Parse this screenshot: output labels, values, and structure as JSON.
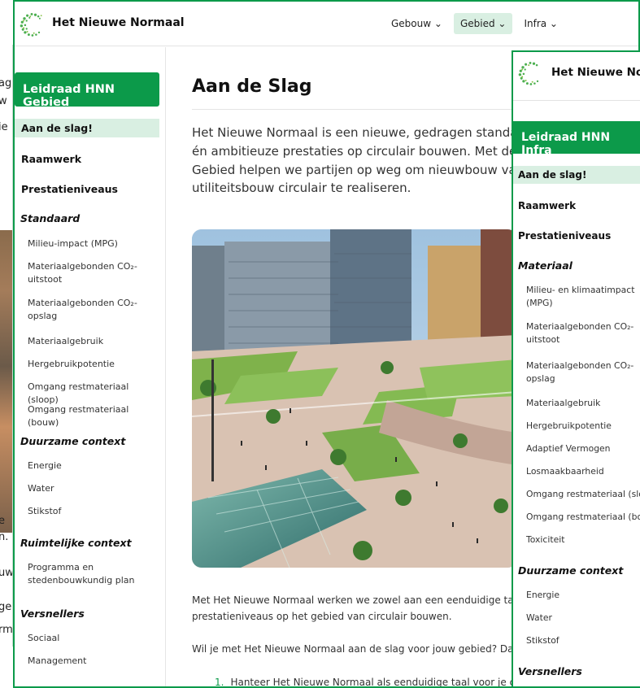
{
  "background_window": {
    "fragments": [
      "ag",
      "w",
      "ie",
      "e",
      "n.",
      "uw",
      "ge",
      "rm"
    ]
  },
  "brand": {
    "name": "Het Nieuwe Normaal"
  },
  "nav": [
    {
      "label": "Gebouw ⌄"
    },
    {
      "label": "Gebied ⌄"
    },
    {
      "label": "Infra ⌄"
    }
  ],
  "sidebar": {
    "title": "Leidraad HNN Gebied",
    "items": [
      {
        "label": "Aan de slag!"
      },
      {
        "label": "Raamwerk"
      },
      {
        "label": "Prestatieniveaus"
      }
    ],
    "sections": [
      {
        "heading": "Standaard",
        "items": [
          "Milieu-impact (MPG)",
          "Materiaalgebonden CO₂-uitstoot",
          "Materiaalgebonden CO₂-opslag",
          "Materiaalgebruik",
          "Hergebruikpotentie",
          "Omgang restmateriaal (sloop)",
          "Omgang restmateriaal (bouw)"
        ]
      },
      {
        "heading": "Duurzame context",
        "items": [
          "Energie",
          "Water",
          "Stikstof"
        ]
      },
      {
        "heading": "Ruimtelijke context",
        "items": [
          "Programma en stedenbouwkundig plan"
        ]
      },
      {
        "heading": "Versnellers",
        "items": [
          "Sociaal",
          "Management"
        ]
      }
    ]
  },
  "content": {
    "title": "Aan de Slag",
    "intro": "Het Nieuwe Normaal is een nieuwe, gedragen standaard én ambitieuze prestaties op circulair bouwen. Met de l Gebied helpen we partijen op weg om nieuwbouw van utiliteitsbouw circulair te realiseren.",
    "intro_lines": [
      "Het Nieuwe Normaal is een nieuwe, gedragen standaa",
      "én ambitieuze prestaties op circulair bouwen. Met de l",
      "Gebied helpen we partijen op weg om nieuwbouw van",
      "utiliteitsbouw circulair te realiseren."
    ],
    "p2_lines": [
      "Met Het Nieuwe Normaal werken we zowel aan een eenduidige taal",
      "prestatieniveaus op het gebied van circulair bouwen."
    ],
    "p3": "Wil je met Het Nieuwe Normaal aan de slag voor jouw gebied? Dan z",
    "list_num": "1.",
    "list_item": "Hanteer Het Nieuwe Normaal als eenduidige taal voor je circ"
  },
  "window2": {
    "brand": "Het Nieuwe Norr",
    "title": "Leidraad HNN Infra",
    "items": [
      "Aan de slag!",
      "Raamwerk",
      "Prestatieniveaus"
    ],
    "section_material": "Materiaal",
    "material_items": [
      "Milieu- en klimaatimpact (MPG)",
      "Materiaalgebonden CO₂-uitstoot",
      "Materiaalgebonden CO₂-opslag",
      "Materiaalgebruik",
      "Hergebruikpotentie",
      "Adaptief Vermogen",
      "Losmaakbaarheid",
      "Omgang restmateriaal (sloo",
      "Omgang restmateriaal (bou",
      "Toxiciteit"
    ],
    "section_context": "Duurzame context",
    "context_items": [
      "Energie",
      "Water",
      "Stikstof"
    ],
    "section_versnellers": "Versnellers"
  },
  "colors": {
    "accent": "#0c9a4a",
    "accent_light": "#d9efe2"
  }
}
